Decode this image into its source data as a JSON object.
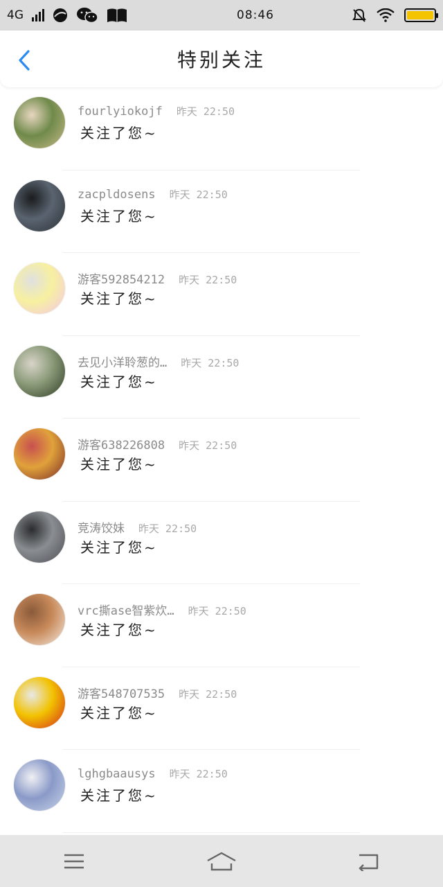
{
  "status_bar": {
    "network": "4G",
    "time": "08:46",
    "icons": [
      "signal-icon",
      "browser-icon",
      "wechat-icon",
      "book-icon",
      "mute-icon",
      "wifi-icon",
      "battery-icon"
    ],
    "battery_color": "#f5c400"
  },
  "header": {
    "title": "特别关注",
    "back_icon": "chevron-left-icon",
    "accent_color": "#2a8cf0"
  },
  "items": [
    {
      "username": "fourlyiokojf",
      "time": "昨天 22:50",
      "message": "关注了您~",
      "avatar_colors": [
        "#c9b98a",
        "#6f8a4a",
        "#e8d6c0"
      ]
    },
    {
      "username": "zacpldosens",
      "time": "昨天 22:50",
      "message": "关注了您~",
      "avatar_colors": [
        "#2a3036",
        "#5a6470",
        "#1a1c1e"
      ]
    },
    {
      "username": "游客592854212",
      "time": "昨天 22:50",
      "message": "关注了您~",
      "avatar_colors": [
        "#f3c6e8",
        "#f7f0a0",
        "#e0e0e0"
      ]
    },
    {
      "username": "去见小洋聆葱的…",
      "time": "昨天 22:50",
      "message": "关注了您~",
      "avatar_colors": [
        "#2d3a22",
        "#8a9a78",
        "#d8d4c8"
      ]
    },
    {
      "username": "游客638226808",
      "time": "昨天 22:50",
      "message": "关注了您~",
      "avatar_colors": [
        "#7a2a2a",
        "#e0a23a",
        "#c85050"
      ]
    },
    {
      "username": "竞涛饺妹",
      "time": "昨天 22:50",
      "message": "关注了您~",
      "avatar_colors": [
        "#4a4e52",
        "#8a8e92",
        "#2a2c2e"
      ]
    },
    {
      "username": "vrc撕ase智紫炊…",
      "time": "昨天 22:50",
      "message": "关注了您~",
      "avatar_colors": [
        "#f4ece4",
        "#c88a5a",
        "#8a5a3a"
      ]
    },
    {
      "username": "游客548707535",
      "time": "昨天 22:50",
      "message": "关注了您~",
      "avatar_colors": [
        "#d42a1e",
        "#f2c200",
        "#e8e8e8"
      ]
    },
    {
      "username": "lghgbaausys",
      "time": "昨天 22:50",
      "message": "关注了您~",
      "avatar_colors": [
        "#c8d4e8",
        "#8a9ac8",
        "#f0f0f4"
      ]
    }
  ],
  "nav_bar": {
    "icons": [
      "menu-icon",
      "home-icon",
      "back-icon"
    ]
  }
}
